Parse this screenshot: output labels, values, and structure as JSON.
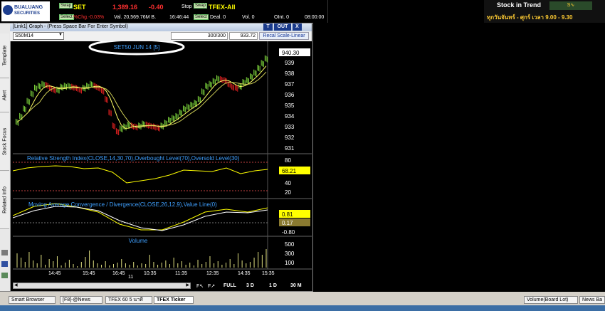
{
  "ticker": {
    "brand_line1": "BUALUANG",
    "brand_line2": "SECURITIES",
    "swap_label": "Swap",
    "select_label": "Select",
    "symbol1": "SET",
    "price1": "1,389.16",
    "change1": "-0.40",
    "pct_change": "%Chg.-0.03%",
    "value1": "Val. 20,569.76M B.",
    "time1": "16:46:44",
    "status": "Stop",
    "symbol2": "TFEX-All",
    "deal": "Deal. 0",
    "vol": "Vol. 0",
    "oint": "OInt. 0",
    "time2": "08:00:00"
  },
  "promo": {
    "line1": "Stock in Trend",
    "line2": "ทุกวันจันทร์ - ศุกร์ เวลา 9.00 - 9.30"
  },
  "window": {
    "title": "[Link1] Graph - (Press Space Bar For Enter Symbol)",
    "btn_t": "T",
    "btn_out": "OUT",
    "btn_x": "X",
    "symbol_input": "S50M14",
    "bars_count": "300/300",
    "last_value": "933.72",
    "recal_label": "Recal Scale-Linear"
  },
  "side_tabs": [
    "Template",
    "Alert",
    "Stock Focus",
    "Related Info"
  ],
  "chart": {
    "title": "SET50 JUN 14  [5]",
    "price_ticks": [
      "939",
      "938",
      "937",
      "936",
      "935",
      "934",
      "933",
      "932",
      "931"
    ],
    "last_price": "940.30",
    "rsi_title": "Relative Strength Index(CLOSE,14,30,70),Overbought Level(70),Oversold Level(30)",
    "rsi_ticks": [
      "80",
      "40",
      "20"
    ],
    "rsi_value": "68.21",
    "macd_title": "Moving Average Convergence / Divergence(CLOSE,26,12,9),Value Line(0)",
    "macd_value1": "0.81",
    "macd_value2": "0.17",
    "macd_tick": "-0.80",
    "vol_title": "Volume",
    "vol_ticks": [
      "500",
      "300",
      "100"
    ],
    "time_labels": [
      "14:45",
      "15:45",
      "16:45",
      "10:35",
      "11:35",
      "12:35",
      "14:35",
      "15:35"
    ],
    "date_label": "11"
  },
  "period_bar": {
    "items": [
      "FULL",
      "3 D",
      "1 D",
      "30 M"
    ]
  },
  "taskbar": {
    "tabs": [
      "Smart Browser",
      "[F8]-@News",
      "TFEX 60 5 นาที",
      "TFEX Ticker"
    ],
    "right_labels": [
      "Volume(Board Lot)",
      "News Ba"
    ]
  },
  "chart_data": {
    "type": "line",
    "title": "SET50 JUN 14  [5]",
    "ylim": [
      930.5,
      940.5
    ],
    "series": [
      {
        "values": [
          933.6,
          934.2,
          935.0,
          935.8,
          936.6,
          937.2,
          937.4,
          937.6,
          937.5,
          937.2,
          937.0,
          937.0,
          937.3,
          937.4,
          937.4,
          937.3,
          937.2,
          937.0,
          937.2,
          937.4,
          937.6,
          937.4,
          937.2,
          936.9,
          936.0,
          934.6,
          933.2,
          932.6,
          932.9,
          933.1,
          933.3,
          933.2,
          933.1,
          933.2,
          933.4,
          933.3,
          933.2,
          933.1,
          933.0,
          933.2,
          933.5,
          933.8,
          934.0,
          934.2,
          934.6,
          935.0,
          935.2,
          935.4,
          935.6,
          936.0,
          936.8,
          937.4,
          937.6,
          937.9,
          938.2,
          938.1,
          938.0,
          937.6,
          937.3,
          937.2,
          937.4,
          937.8,
          938.0,
          938.4,
          938.8,
          939.3,
          939.8,
          940.3
        ]
      }
    ]
  }
}
